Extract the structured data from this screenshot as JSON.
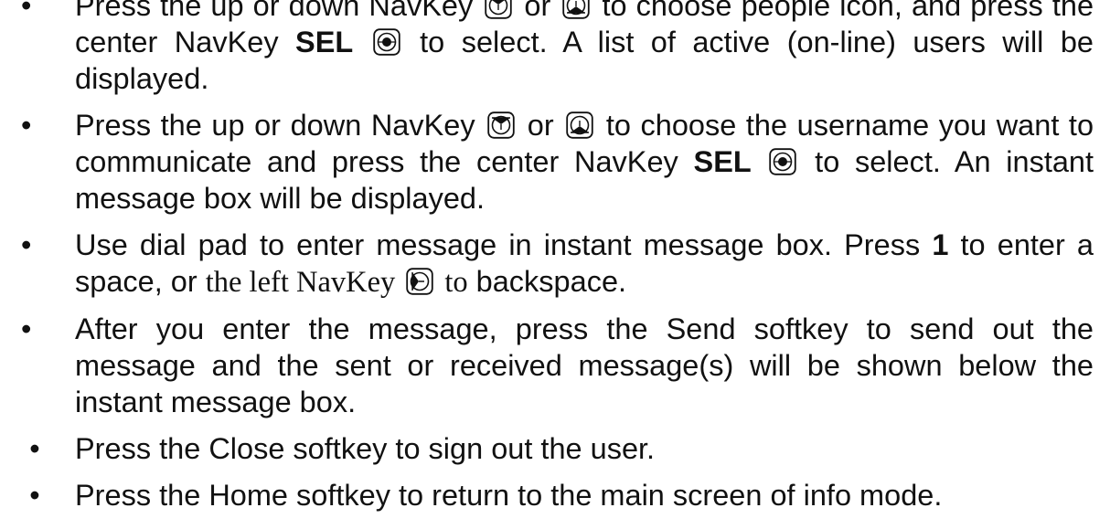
{
  "bullet_glyph": "•",
  "icons": {
    "up": "navkey-up-icon",
    "down": "navkey-down-icon",
    "center": "navkey-center-icon",
    "left": "navkey-left-icon"
  },
  "items": [
    {
      "t1": "Press the up or down NavKey",
      "t2": "or",
      "t3": "to choose people icon, and press the center NavKey",
      "t4": "SEL",
      "t5": "to select. A list of active (on-line) users will be displayed."
    },
    {
      "t1": "Press the up or down NavKey",
      "t2": "or",
      "t3": "to choose the username you want to communicate and press the center NavKey",
      "t4": "SEL",
      "t5": "to select. An instant message box will be displayed."
    },
    {
      "t1": "Use dial pad to enter message in instant message box. Press",
      "t2": "1",
      "t3": "to enter a space, or",
      "t4": "the left NavKey",
      "t5": "to",
      "t6": "backspace."
    },
    {
      "t1": "After you enter the message, press the Send softkey to send out the message and the sent or received message(s) will be shown below the instant message box."
    },
    {
      "t1": "Press the Close softkey to sign out the user."
    },
    {
      "t1": "Press the Home softkey to return to the main screen of info mode."
    }
  ]
}
